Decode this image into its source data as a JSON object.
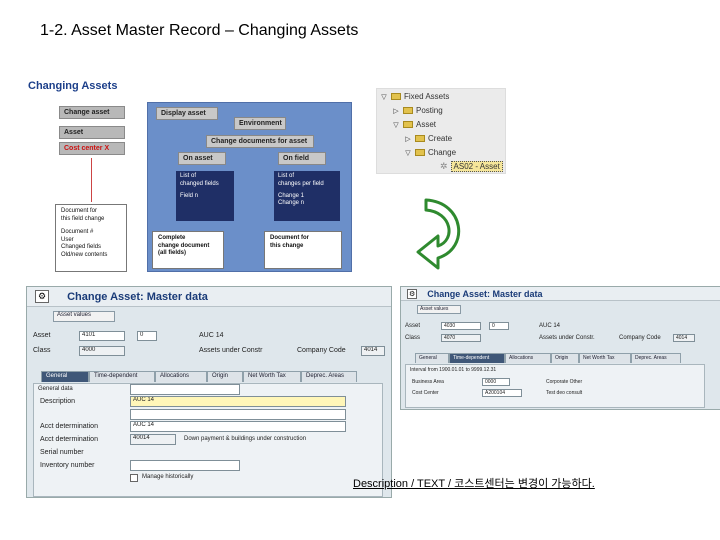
{
  "slide": {
    "title": "1-2. Asset Master Record – Changing Assets",
    "caption": "Description / TEXT / 코스트센터는 변경이 가능하다."
  },
  "diagram": {
    "title": "Changing Assets",
    "change_asset": "Change asset",
    "asset": "Asset",
    "cost_center": "Cost center X",
    "doc_left_1": "Document for",
    "doc_left_2": "this field change",
    "doc_left_3": "Document #",
    "doc_left_4": "User",
    "doc_left_5": "Changed fields",
    "doc_left_6": "Old/new contents",
    "display_asset": "Display asset",
    "environment": "Environment",
    "change_docs": "Change documents for asset",
    "on_asset": "On asset",
    "on_field": "On field",
    "list_changed_1": "List of",
    "list_changed_2": "changed fields",
    "field_n": "Field n",
    "list_changes_1": "List of",
    "list_changes_2": "changes per field",
    "change_1": "Change 1",
    "change_n": "Change n",
    "complete_1": "Complete",
    "complete_2": "change document",
    "complete_3": "(all fields)",
    "doc_right_1": "Document for",
    "doc_right_2": "this change"
  },
  "tree": {
    "items": [
      "Fixed Assets",
      "Posting",
      "Asset",
      "Create",
      "Change",
      "AS02 - Asset"
    ]
  },
  "sap_left": {
    "title": "Change Asset:  Master data",
    "values_btn": "Asset values",
    "asset_label": "Asset",
    "asset_value": "4101",
    "asset_sub": "0",
    "asset_desc": "AUC 14",
    "class_label": "Class",
    "class_value": "4000",
    "class_desc": "Assets under Constr",
    "company_label": "Company Code",
    "company_value": "4014",
    "tabs": [
      "General",
      "Time-dependent",
      "Allocations",
      "Origin",
      "Net Worth Tax",
      "Deprec. Areas"
    ],
    "group_label": "General data",
    "rows": [
      {
        "label": "Description",
        "value": "AUC 14"
      },
      {
        "label": "",
        "value": ""
      },
      {
        "label": "Acct determination",
        "value": "AUC 14"
      },
      {
        "label": "Acct determination",
        "value": "40014"
      },
      {
        "label": "Serial number",
        "value": ""
      },
      {
        "label": "Inventory number",
        "value": ""
      }
    ],
    "acct_desc": "Down payment & buildings under construction",
    "checkbox_label": "Manage historically"
  },
  "sap_right": {
    "title": "Change Asset:  Master data",
    "values_btn": "Asset values",
    "asset_label": "Asset",
    "asset_value": "4030",
    "asset_sub": "0",
    "asset_desc": "AUC 14",
    "class_label": "Class",
    "class_value": "4070",
    "class_desc": "Assets under Constr.",
    "company_label": "Company Code",
    "company_value": "4014",
    "tabs": [
      "General",
      "Time-dependent",
      "Allocations",
      "Origin",
      "Net Worth Tax",
      "Deprec. Areas"
    ],
    "interval": "Interval from 1900.01.01 to 9999.12.31",
    "bus_area_label": "Business Area",
    "bus_area_value": "0000",
    "cost_center_label": "Cost Center",
    "cost_center_value": "A200104",
    "corp_label": "Corporate Other",
    "cc_desc": "Test deo consult"
  },
  "colors": {
    "title_blue": "#1a3b78",
    "panel_blue": "#6b8fc9",
    "arrow_green": "#2f8a2f",
    "tab_active": "#3f5778"
  }
}
